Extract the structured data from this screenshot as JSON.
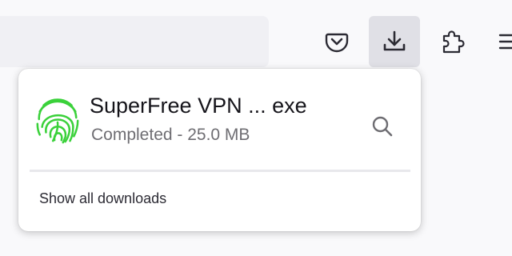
{
  "toolbar": {
    "buttons": [
      {
        "name": "pocket-icon"
      },
      {
        "name": "downloads-icon",
        "active": true
      },
      {
        "name": "extensions-icon"
      },
      {
        "name": "menu-icon"
      }
    ]
  },
  "downloads_panel": {
    "item": {
      "icon": "fingerprint-icon",
      "icon_color": "#3ad13a",
      "filename": "SuperFree VPN ... exe",
      "status": "Completed - 25.0 MB",
      "action_icon": "magnifier-icon"
    },
    "show_all_label": "Show all downloads"
  },
  "colors": {
    "active_button_bg": "#e0e0e6",
    "panel_bg": "#ffffff",
    "text_primary": "#15141a",
    "text_secondary": "#6e6d72"
  }
}
